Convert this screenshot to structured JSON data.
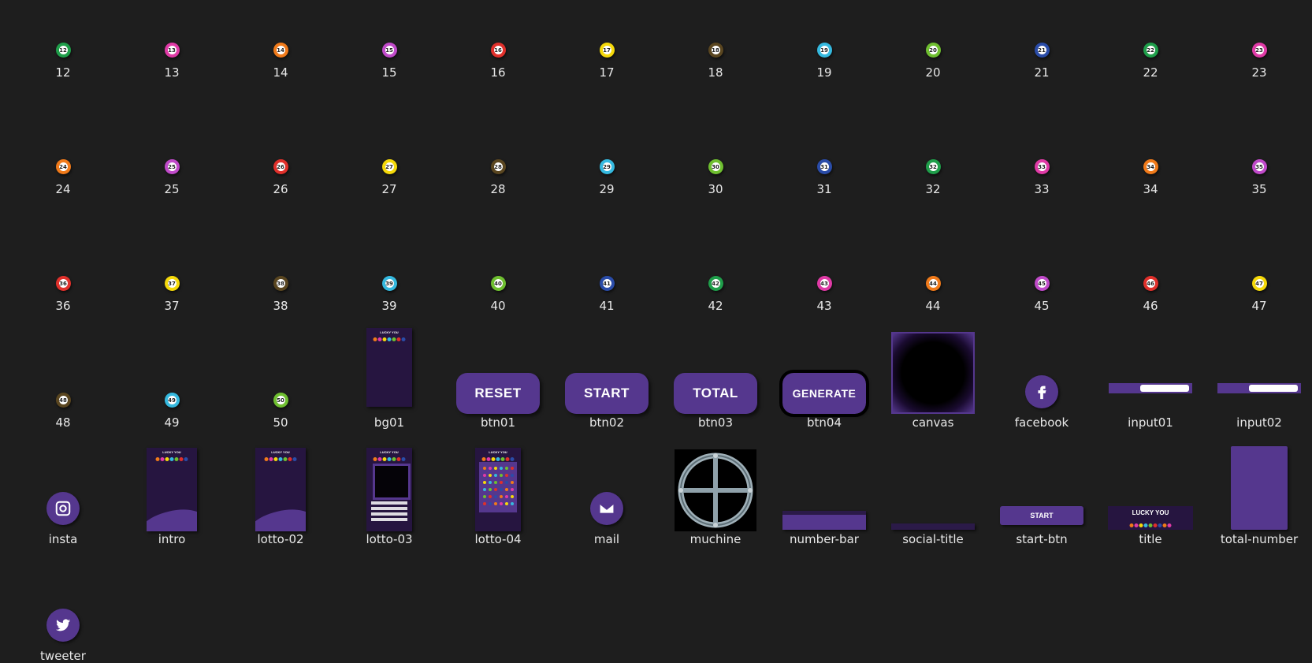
{
  "assets": [
    {
      "name": "12",
      "kind": "ball",
      "color": "#1f9e4a"
    },
    {
      "name": "13",
      "kind": "ball",
      "color": "#e03aa6"
    },
    {
      "name": "14",
      "kind": "ball",
      "color": "#f07a1a"
    },
    {
      "name": "15",
      "kind": "ball",
      "color": "#c04ac9"
    },
    {
      "name": "16",
      "kind": "ball",
      "color": "#e0302b"
    },
    {
      "name": "17",
      "kind": "ball",
      "color": "#f5d90a"
    },
    {
      "name": "18",
      "kind": "ball",
      "color": "#5a4620"
    },
    {
      "name": "19",
      "kind": "ball",
      "color": "#35b9df"
    },
    {
      "name": "20",
      "kind": "ball",
      "color": "#6fbf30"
    },
    {
      "name": "21",
      "kind": "ball",
      "color": "#2a4ca8"
    },
    {
      "name": "22",
      "kind": "ball",
      "color": "#1f9e4a"
    },
    {
      "name": "23",
      "kind": "ball",
      "color": "#e03aa6"
    },
    {
      "name": "24",
      "kind": "ball",
      "color": "#f07a1a"
    },
    {
      "name": "25",
      "kind": "ball",
      "color": "#c04ac9"
    },
    {
      "name": "26",
      "kind": "ball",
      "color": "#e0302b"
    },
    {
      "name": "27",
      "kind": "ball",
      "color": "#f5d90a"
    },
    {
      "name": "28",
      "kind": "ball",
      "color": "#5a4620"
    },
    {
      "name": "29",
      "kind": "ball",
      "color": "#35b9df"
    },
    {
      "name": "30",
      "kind": "ball",
      "color": "#6fbf30"
    },
    {
      "name": "31",
      "kind": "ball",
      "color": "#2a4ca8"
    },
    {
      "name": "32",
      "kind": "ball",
      "color": "#1f9e4a"
    },
    {
      "name": "33",
      "kind": "ball",
      "color": "#e03aa6"
    },
    {
      "name": "34",
      "kind": "ball",
      "color": "#f07a1a"
    },
    {
      "name": "35",
      "kind": "ball",
      "color": "#c04ac9"
    },
    {
      "name": "36",
      "kind": "ball",
      "color": "#e0302b"
    },
    {
      "name": "37",
      "kind": "ball",
      "color": "#f5d90a"
    },
    {
      "name": "38",
      "kind": "ball",
      "color": "#5a4620"
    },
    {
      "name": "39",
      "kind": "ball",
      "color": "#35b9df"
    },
    {
      "name": "40",
      "kind": "ball",
      "color": "#6fbf30"
    },
    {
      "name": "41",
      "kind": "ball",
      "color": "#2a4ca8"
    },
    {
      "name": "42",
      "kind": "ball",
      "color": "#1f9e4a"
    },
    {
      "name": "43",
      "kind": "ball",
      "color": "#e03aa6"
    },
    {
      "name": "44",
      "kind": "ball",
      "color": "#f07a1a"
    },
    {
      "name": "45",
      "kind": "ball",
      "color": "#c04ac9"
    },
    {
      "name": "46",
      "kind": "ball",
      "color": "#e0302b"
    },
    {
      "name": "47",
      "kind": "ball",
      "color": "#f5d90a"
    },
    {
      "name": "48",
      "kind": "ball",
      "color": "#5a4620"
    },
    {
      "name": "49",
      "kind": "ball",
      "color": "#35b9df"
    },
    {
      "name": "50",
      "kind": "ball",
      "color": "#6fbf30"
    },
    {
      "name": "bg01",
      "kind": "phone",
      "title": "LUCKY YOU"
    },
    {
      "name": "btn01",
      "kind": "button",
      "text": "RESET"
    },
    {
      "name": "btn02",
      "kind": "button",
      "text": "START"
    },
    {
      "name": "btn03",
      "kind": "button",
      "text": "TOTAL"
    },
    {
      "name": "btn04",
      "kind": "button",
      "text": "GENERATE",
      "dark": true
    },
    {
      "name": "canvas",
      "kind": "canvas"
    },
    {
      "name": "facebook",
      "kind": "social",
      "icon": "facebook-icon"
    },
    {
      "name": "input01",
      "kind": "input"
    },
    {
      "name": "input02",
      "kind": "input"
    },
    {
      "name": "insta",
      "kind": "social",
      "icon": "instagram-icon"
    },
    {
      "name": "intro",
      "kind": "phone",
      "title": "LUCKY YOU"
    },
    {
      "name": "lotto-02",
      "kind": "phone",
      "title": "LUCKY YOU"
    },
    {
      "name": "lotto-03",
      "kind": "phone",
      "title": "LUCKY YOU"
    },
    {
      "name": "lotto-04",
      "kind": "phone",
      "title": "LUCKY YOU"
    },
    {
      "name": "mail",
      "kind": "social",
      "icon": "mail-icon"
    },
    {
      "name": "muchine",
      "kind": "machine"
    },
    {
      "name": "number-bar",
      "kind": "numberbar"
    },
    {
      "name": "social-title",
      "kind": "socialtitle"
    },
    {
      "name": "start-btn",
      "kind": "startbtn",
      "text": "START"
    },
    {
      "name": "title",
      "kind": "titleimg",
      "title": "LUCKY YOU"
    },
    {
      "name": "total-number",
      "kind": "totalnumber"
    },
    {
      "name": "tweeter",
      "kind": "social",
      "icon": "twitter-icon"
    }
  ],
  "colors": {
    "background": "#1e1e1e",
    "accent": "#55378e",
    "dark_panel": "#261540"
  }
}
